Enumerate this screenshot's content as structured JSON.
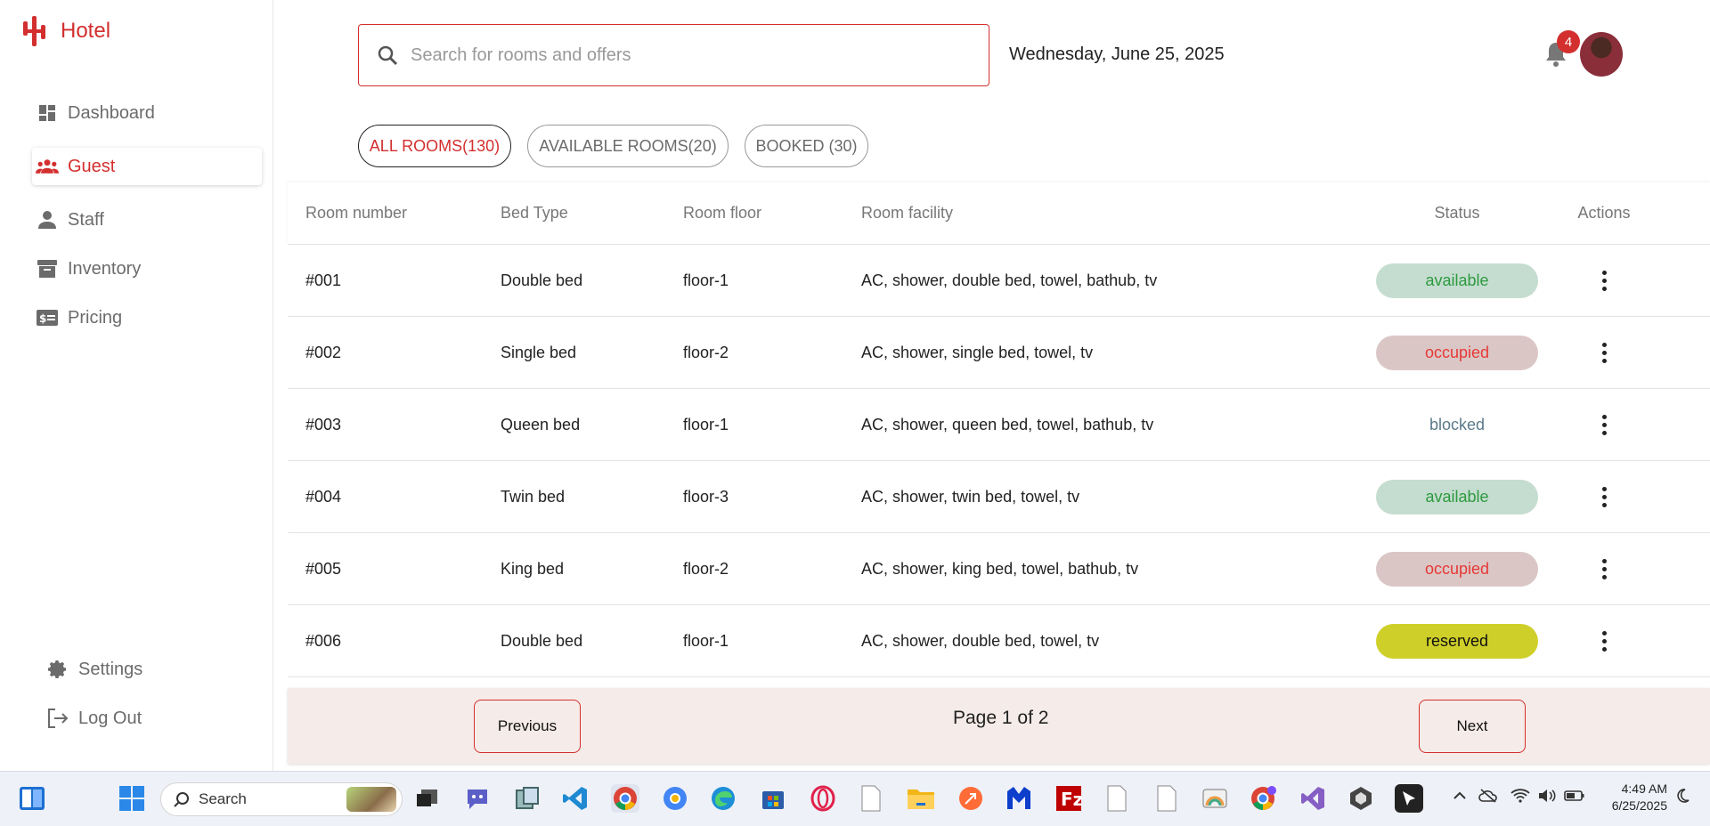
{
  "app": {
    "title": "Hotel"
  },
  "sidebar": {
    "items": [
      {
        "label": "Dashboard",
        "icon": "dashboard-icon",
        "active": false
      },
      {
        "label": "Guest",
        "icon": "group-icon",
        "active": true
      },
      {
        "label": "Staff",
        "icon": "person-icon",
        "active": false
      },
      {
        "label": "Inventory",
        "icon": "archive-icon",
        "active": false
      },
      {
        "label": "Pricing",
        "icon": "price-tag-icon",
        "active": false
      }
    ],
    "bottom": [
      {
        "label": "Settings",
        "icon": "gear-icon"
      },
      {
        "label": "Log Out",
        "icon": "logout-icon"
      }
    ]
  },
  "header": {
    "search_placeholder": "Search for rooms and offers",
    "date": "Wednesday, June 25, 2025",
    "notifications": "4"
  },
  "tabs": [
    {
      "label": "ALL ROOMS(130)",
      "active": true
    },
    {
      "label": "AVAILABLE ROOMS(20)",
      "active": false
    },
    {
      "label": "BOOKED (30)",
      "active": false
    }
  ],
  "table": {
    "headers": [
      "Room number",
      "Bed Type",
      "Room floor",
      "Room facility",
      "Status",
      "Actions"
    ],
    "rows": [
      {
        "number": "#001",
        "bed": "Double bed",
        "floor": "floor-1",
        "facility": "AC, shower, double bed, towel, bathub, tv",
        "status": "available"
      },
      {
        "number": "#002",
        "bed": "Single bed",
        "floor": "floor-2",
        "facility": "AC, shower, single bed, towel, tv",
        "status": "occupied"
      },
      {
        "number": "#003",
        "bed": "Queen bed",
        "floor": "floor-1",
        "facility": "AC, shower, queen bed, towel, bathub, tv",
        "status": "blocked"
      },
      {
        "number": "#004",
        "bed": "Twin bed",
        "floor": "floor-3",
        "facility": "AC, shower, twin bed, towel, tv",
        "status": "available"
      },
      {
        "number": "#005",
        "bed": "King bed",
        "floor": "floor-2",
        "facility": "AC, shower, king bed, towel, bathub, tv",
        "status": "occupied"
      },
      {
        "number": "#006",
        "bed": "Double bed",
        "floor": "floor-1",
        "facility": "AC, shower, double bed, towel, tv",
        "status": "reserved"
      }
    ]
  },
  "status_styles": {
    "available": {
      "bg": "#c5ddd0",
      "fg": "#2e9a3f"
    },
    "occupied": {
      "bg": "#dbc6c6",
      "fg": "#e53935"
    },
    "blocked": {
      "bg": "transparent",
      "fg": "#5a7a8a"
    },
    "reserved": {
      "bg": "#cfcf2a",
      "fg": "#111111"
    }
  },
  "pagination": {
    "previous": "Previous",
    "page_text": "Page 1 of 2",
    "next": "Next"
  },
  "taskbar": {
    "search_label": "Search",
    "time": "4:49 AM",
    "date": "6/25/2025"
  },
  "colors": {
    "accent": "#d32f2f"
  }
}
